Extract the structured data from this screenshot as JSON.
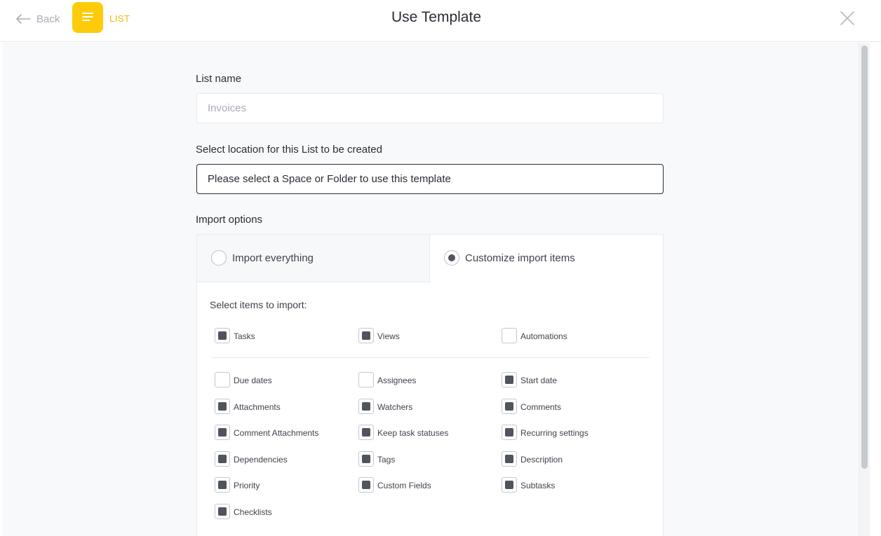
{
  "header": {
    "back_label": "Back",
    "list_label": "LIST",
    "title": "Use Template"
  },
  "form": {
    "list_name_label": "List name",
    "list_name_placeholder": "Invoices",
    "location_label": "Select location for this List to be created",
    "location_value": "Please select a Space or Folder to use this template",
    "import_label": "Import options"
  },
  "import_options": {
    "everything_label": "Import everything",
    "customize_label": "Customize import items",
    "selected": "customize",
    "select_title": "Select items to import:"
  },
  "items_top": [
    {
      "label": "Tasks",
      "checked": true
    },
    {
      "label": "Views",
      "checked": true
    },
    {
      "label": "Automations",
      "checked": false
    }
  ],
  "items": [
    {
      "label": "Due dates",
      "checked": false
    },
    {
      "label": "Assignees",
      "checked": false
    },
    {
      "label": "Start date",
      "checked": true
    },
    {
      "label": "Attachments",
      "checked": true
    },
    {
      "label": "Watchers",
      "checked": true
    },
    {
      "label": "Comments",
      "checked": true
    },
    {
      "label": "Comment Attachments",
      "checked": true
    },
    {
      "label": "Keep task statuses",
      "checked": true
    },
    {
      "label": "Recurring settings",
      "checked": true
    },
    {
      "label": "Dependencies",
      "checked": true
    },
    {
      "label": "Tags",
      "checked": true
    },
    {
      "label": "Description",
      "checked": true
    },
    {
      "label": "Priority",
      "checked": true
    },
    {
      "label": "Custom Fields",
      "checked": true
    },
    {
      "label": "Subtasks",
      "checked": true
    },
    {
      "label": "Checklists",
      "checked": true
    }
  ],
  "colors": {
    "list_accent": "#fdcb0a",
    "list_label": "#f2b705",
    "check_fill": "#50545c"
  },
  "icons": {
    "back": "arrow-left-icon",
    "list": "list-lines-icon",
    "close": "close-x-icon"
  }
}
